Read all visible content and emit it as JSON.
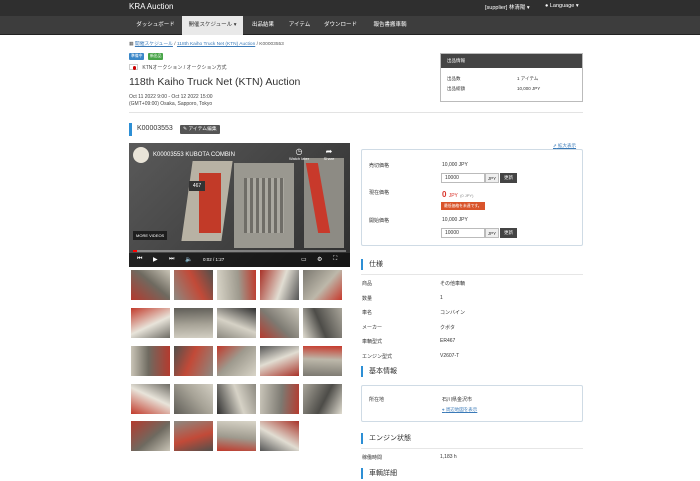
{
  "header": {
    "brand": "KRA Auction",
    "user": "[supplier] 林清陽 ▾",
    "language": "Language ▾"
  },
  "nav": {
    "items": [
      "ダッシュボード",
      "開催スケジュール ▾",
      "出品結果",
      "アイテム",
      "ダウンロード",
      "報告書搬車輌"
    ]
  },
  "breadcrumb": {
    "link1": "開催スケジュール",
    "link2": "118th Kaiho Truck Net (KTN) Auction",
    "current": "K00003553",
    "sep": "/"
  },
  "tags": [
    "準備中",
    "新出品"
  ],
  "auction": {
    "subtitle": "KTNオークション / オークション方式",
    "title": "118th Kaiho Truck Net (KTN) Auction",
    "dates": "Oct 11 2022 9:00 - Oct 12 2022 15:00",
    "timezone": "(GMT+09:00) Osaka, Sapporo, Tokyo"
  },
  "listing_info": {
    "heading": "出品情報",
    "rows": [
      {
        "label": "出品数",
        "value": "1 アイテム"
      },
      {
        "label": "出品総額",
        "value": "10,000 JPY"
      }
    ]
  },
  "lot": {
    "number": "K00003553",
    "edit_button": "アイテム編集",
    "zoom_link": "拡大表示"
  },
  "video": {
    "title": "K00003553 KUBOTA COMBIN",
    "watch_later": "Watch later",
    "share": "Share",
    "more_videos": "MORE VIDEOS",
    "time": "0:02 / 1:27",
    "progress": 0.02
  },
  "price": {
    "sell_label": "売切価格",
    "sell_value": "10,000 JPY",
    "sell_input": "10000",
    "current_label": "現在価格",
    "current_value": "0",
    "current_unit": "JPY",
    "current_note": "(0 JPY)",
    "current_badge": "最低価格を未達です。",
    "start_label": "開始価格",
    "start_value": "10,000 JPY",
    "start_input": "10000",
    "unit": "JPY",
    "update": "更新"
  },
  "specs": {
    "heading": "仕様",
    "rows": [
      {
        "label": "商品",
        "value": "その他車輌"
      },
      {
        "label": "数量",
        "value": "1"
      },
      {
        "label": "車名",
        "value": "コンバイン"
      },
      {
        "label": "メーカー",
        "value": "クボタ"
      },
      {
        "label": "車輌型式",
        "value": "ER467"
      },
      {
        "label": "エンジン型式",
        "value": "V2607-T"
      }
    ]
  },
  "basic": {
    "heading": "基本情報",
    "location_label": "所在地",
    "location_value": "石川県金沢市",
    "map_link": "周辺地図を表示"
  },
  "engine": {
    "heading": "エンジン状態",
    "hours_label": "稼働時間",
    "hours_value": "1,183 h"
  },
  "vehicle": {
    "heading": "車輌詳細"
  },
  "colors": {
    "accent_blue": "#2d8fd5",
    "nav_dark": "#3d3d3d",
    "header_dark": "#2f2f2f",
    "price_red": "#d9342b",
    "tag_blue": "#3a87c8",
    "tag_green": "#47a447"
  },
  "icons": {
    "clock": "watch-later-icon",
    "share": "share-icon",
    "play": "play-icon",
    "prev": "skip-previous-icon",
    "next": "skip-next-icon",
    "volume": "volume-icon",
    "subtitles": "subtitles-icon",
    "settings": "gear-icon",
    "fullscreen": "fullscreen-icon",
    "edit": "edit-icon",
    "link": "link-icon",
    "map": "map-marker-icon"
  }
}
